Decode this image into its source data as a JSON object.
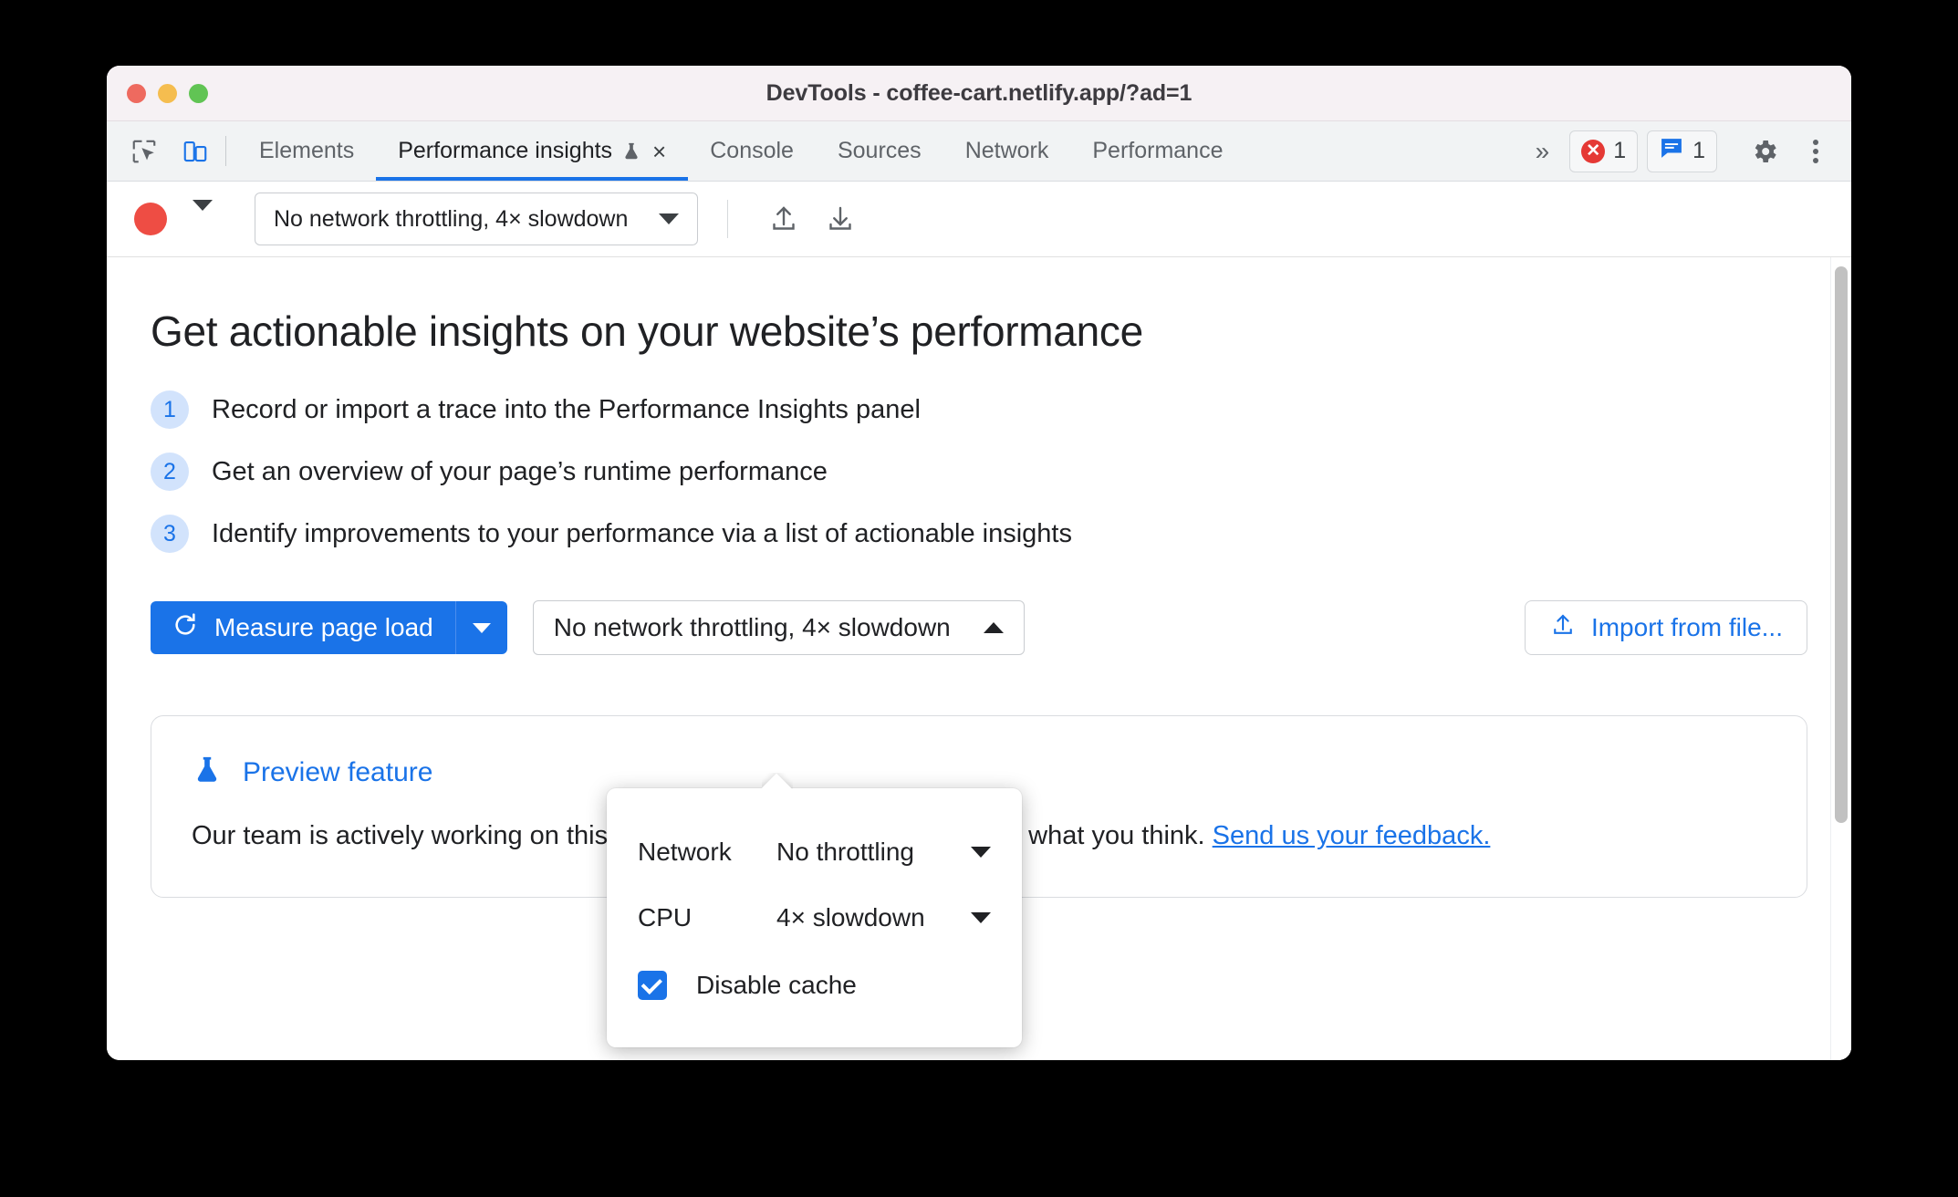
{
  "window": {
    "title": "DevTools - coffee-cart.netlify.app/?ad=1",
    "traffic_lights": [
      "close",
      "minimize",
      "maximize"
    ]
  },
  "tabbar": {
    "left_icons": [
      {
        "name": "inspect-element-icon",
        "label": "Inspect element"
      },
      {
        "name": "device-toolbar-icon",
        "label": "Toggle device toolbar"
      }
    ],
    "tabs": [
      {
        "label": "Elements",
        "active": false
      },
      {
        "label": "Performance insights",
        "active": true,
        "has_flask": true,
        "close_glyph": "×"
      },
      {
        "label": "Console",
        "active": false
      },
      {
        "label": "Sources",
        "active": false
      },
      {
        "label": "Network",
        "active": false
      },
      {
        "label": "Performance",
        "active": false
      }
    ],
    "more_tabs_glyph": "»",
    "error_badge": {
      "count": "1",
      "glyph": "✕"
    },
    "message_badge": {
      "count": "1"
    },
    "settings_label": "Settings",
    "more_options_label": "Customize and control DevTools"
  },
  "toolbar": {
    "record_label": "Record",
    "throttling_value": "No network throttling, 4× slowdown",
    "upload_label": "Save profile",
    "download_label": "Load profile"
  },
  "main": {
    "heading": "Get actionable insights on your website’s performance",
    "steps": [
      {
        "num": "1",
        "text": "Record or import a trace into the Performance Insights panel"
      },
      {
        "num": "2",
        "text": "Get an overview of your page’s runtime performance"
      },
      {
        "num": "3",
        "text": "Identify improvements to your performance via a list of actionable insights"
      }
    ],
    "measure_button": "Measure page load",
    "throttling_select_value": "No network throttling, 4× slowdown",
    "import_button": "Import from file...",
    "preview": {
      "title": "Preview feature",
      "body_before_link": "Our team is actively working on this feature and we would love to know what you think. ",
      "link_text": "Send us your feedback."
    }
  },
  "popup": {
    "rows": [
      {
        "label": "Network",
        "value": "No throttling"
      },
      {
        "label": "CPU",
        "value": "4× slowdown"
      }
    ],
    "checkbox": {
      "label": "Disable cache",
      "checked": true
    }
  },
  "colors": {
    "accent_blue": "#1a73e8",
    "error_red": "#e53935",
    "step_bg": "#d2e3fc",
    "record_red": "#ee4d44"
  }
}
